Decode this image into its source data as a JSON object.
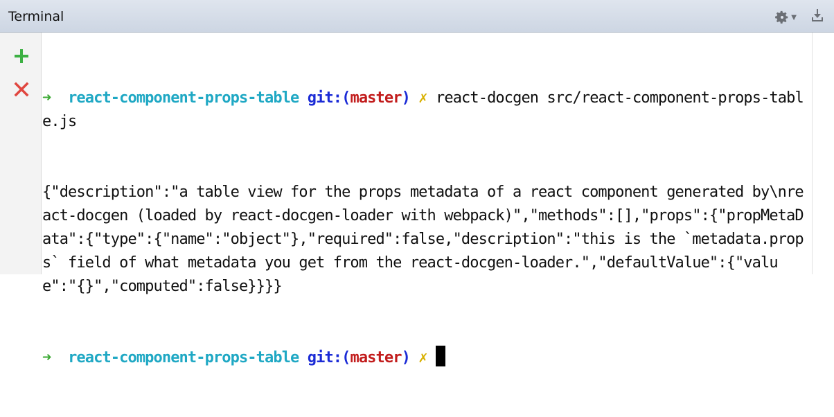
{
  "window": {
    "title": "Terminal"
  },
  "toolbar": {
    "settings_icon": "gear-icon",
    "hide_icon": "hide-panel-icon"
  },
  "sidebar": {
    "add_icon": "plus-icon",
    "close_icon": "close-icon"
  },
  "colors": {
    "prompt_arrow": "#3aa832",
    "directory": "#1fa8c4",
    "git_label": "#1b2bd6",
    "branch": "#c21c1c",
    "dirty_marker": "#d8b000"
  },
  "terminal": {
    "prompt1": {
      "arrow": "➜",
      "directory": "react-component-props-table",
      "git_label": "git:(",
      "branch": "master",
      "git_close": ")",
      "dirty": "✗",
      "command": "react-docgen src/react-component-props-table.js"
    },
    "output": "{\"description\":\"a table view for the props metadata of a react component generated by\\nreact-docgen (loaded by react-docgen-loader with webpack)\",\"methods\":[],\"props\":{\"propMetaData\":{\"type\":{\"name\":\"object\"},\"required\":false,\"description\":\"this is the `metadata.props` field of what metadata you get from the react-docgen-loader.\",\"defaultValue\":{\"value\":\"{}\",\"computed\":false}}}}",
    "prompt2": {
      "arrow": "➜",
      "directory": "react-component-props-table",
      "git_label": "git:(",
      "branch": "master",
      "git_close": ")",
      "dirty": "✗"
    }
  }
}
